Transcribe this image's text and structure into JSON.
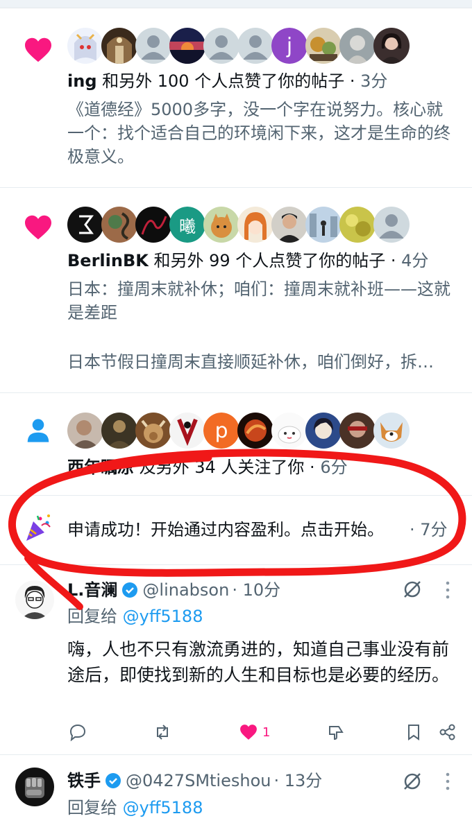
{
  "colors": {
    "like": "#f91880",
    "accent": "#1d9bf0",
    "grey": "#536471",
    "text": "#0f1419",
    "annotation": "#f01818"
  },
  "notifications": [
    {
      "icon": "heart-icon",
      "name": "ing",
      "action": " 和另外 100 个人点赞了你的帖子 · ",
      "time": "3分",
      "body": "《道德经》5000多字，没一个字在说努力。核心就一个：找个适合自己的环境闲下来，这才是生命的终极意义。"
    },
    {
      "icon": "heart-icon",
      "name": "BerlinBK",
      "action": " 和另外 99 个人点赞了你的帖子 · ",
      "time": "4分",
      "body_line1": "日本：撞周末就补休；咱们：撞周末就补班——这就是差距",
      "body_line2": "日本节假日撞周末直接顺延补休，咱们倒好，拆…"
    },
    {
      "icon": "person-icon",
      "avatar_letter": "曦",
      "name": "西年瞩凉",
      "action": " 及另外 34 人关注了你 · ",
      "time": "6分"
    },
    {
      "icon": "party-popper-icon",
      "text": "申请成功！开始通过内容盈利。点击开始。",
      "time": "· 7分"
    }
  ],
  "avatar_letters": {
    "j": "j",
    "xi": "曦",
    "p": "p"
  },
  "tweets": [
    {
      "name": "L.音澜",
      "handle": "@linabson",
      "time": "· 10分",
      "reply_prefix": "回复给 ",
      "reply_to": "@yff5188",
      "text": "嗨，人也不只有激流勇进的，知道自己事业没有前途后，即使找到新的人生和目标也是必要的经历。",
      "likes": "1"
    },
    {
      "name": "铁手",
      "handle": "@0427SMtieshou",
      "time": "· 13分",
      "reply_prefix": "回复给 ",
      "reply_to": "@yff5188"
    }
  ]
}
